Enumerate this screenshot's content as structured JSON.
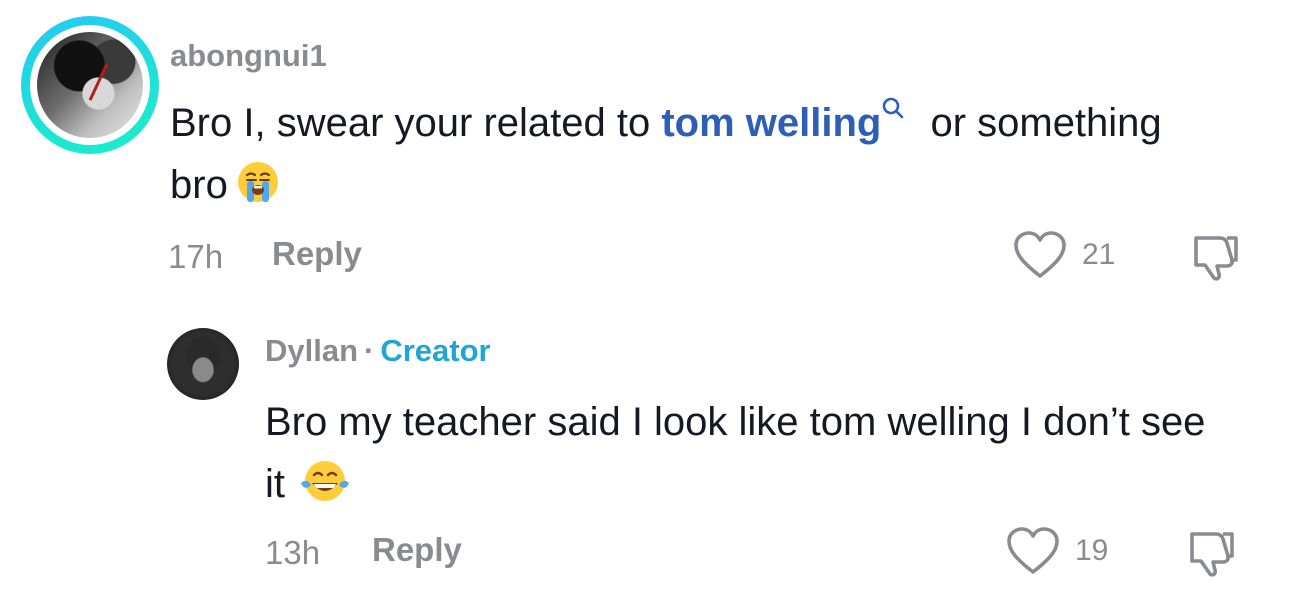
{
  "comments": [
    {
      "username": "abongnui1",
      "text_before": "Bro I, swear your related to ",
      "link_text": "tom welling",
      "text_after": " or something bro",
      "emoji": "loudly-crying-face",
      "time": "17h",
      "reply_label": "Reply",
      "likes": "21"
    },
    {
      "username": "Dyllan",
      "separator": "·",
      "badge": "Creator",
      "text": "Bro my teacher said I look like tom welling I don’t see it",
      "emoji": "face-with-tears-of-joy",
      "time": "13h",
      "reply_label": "Reply",
      "likes": "19"
    }
  ],
  "colors": {
    "link": "#2d5fb8",
    "creator": "#20a6d6",
    "muted": "#8a8b91",
    "ring": "#25c8f4"
  }
}
